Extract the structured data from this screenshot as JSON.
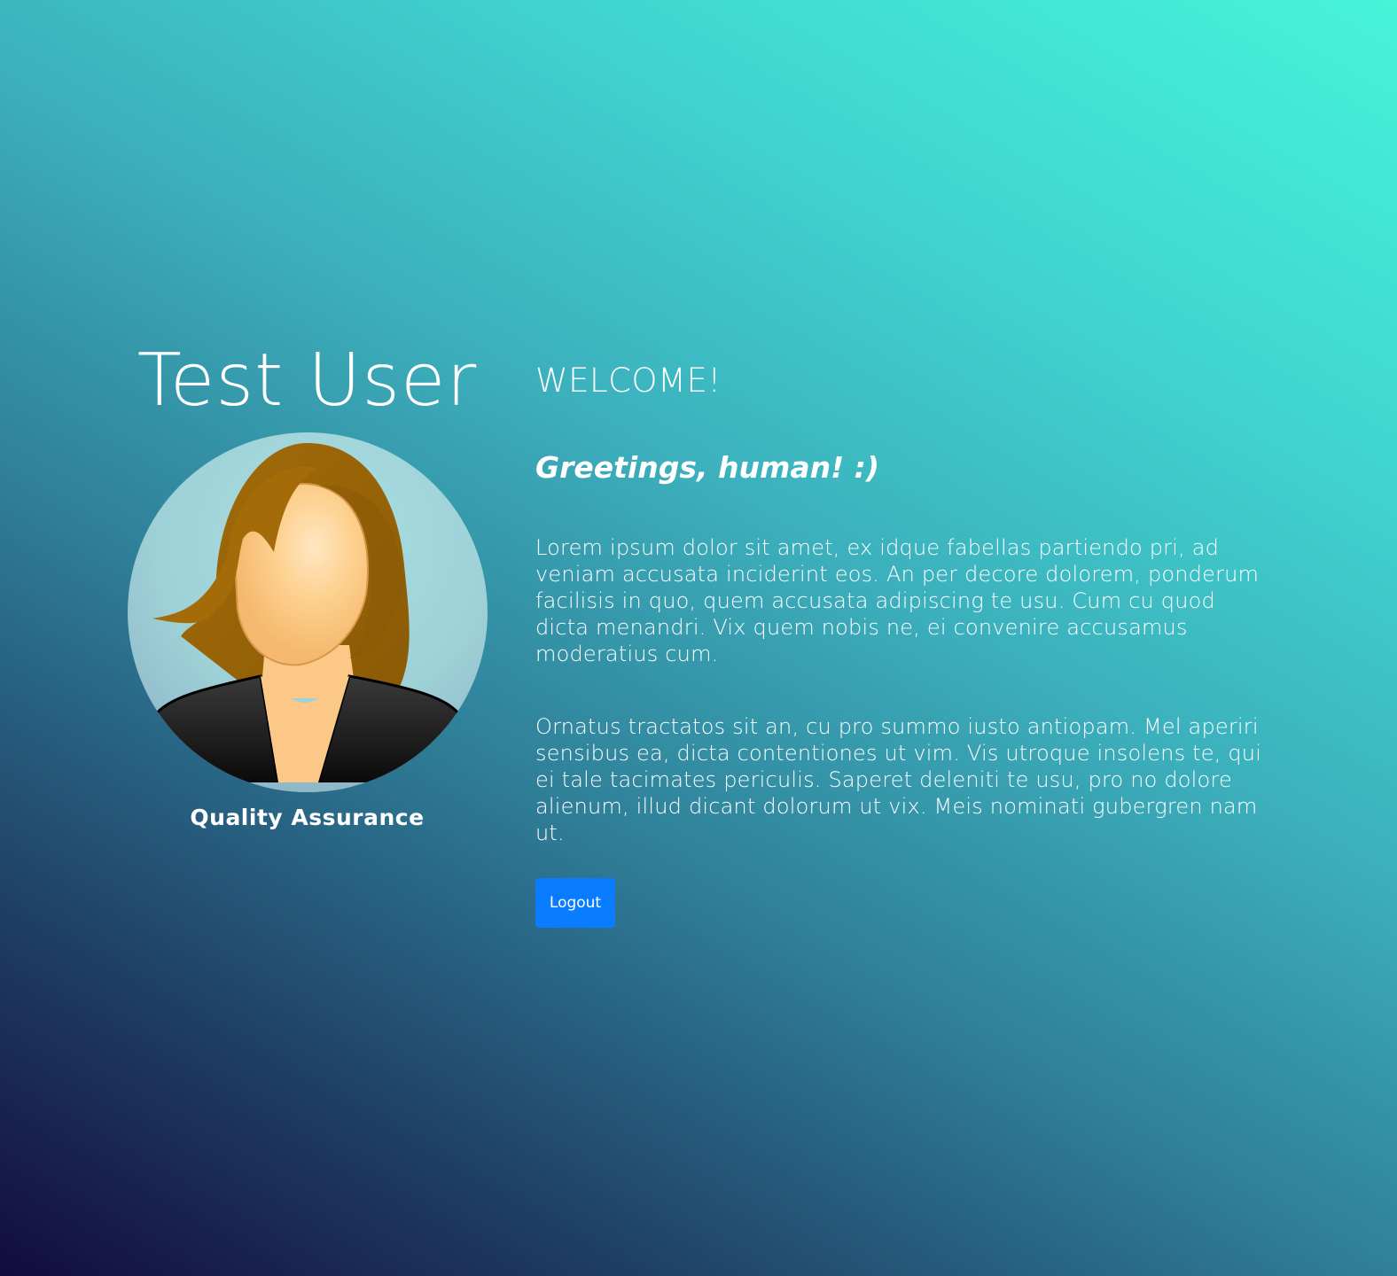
{
  "profile": {
    "name": "Test User",
    "role": "Quality Assurance",
    "avatar_icon": "female-user-avatar-icon"
  },
  "main": {
    "heading": "WELCOME!",
    "greeting": "Greetings, human! :)",
    "paragraphs": [
      "Lorem ipsum dolor sit amet, ex idque fabellas partiendo pri, ad veniam accusata inciderint eos. An per decore dolorem, ponderum facilisis in quo, quem accusata adipiscing te usu. Cum cu quod dicta menandri. Vix quem nobis ne, ei convenire accusamus moderatius cum.",
      "Ornatus tractatos sit an, cu pro summo iusto antiopam. Mel aperiri sensibus ea, dicta contentiones ut vim. Vis utroque insolens te, qui ei tale tacimates periculis. Saperet deleniti te usu, pro no dolore alienum, illud dicant dolorum ut vix. Meis nominati gubergren nam ut."
    ],
    "logout_label": "Logout"
  },
  "colors": {
    "accent": "#0a7cff",
    "gradient_start": "#130b3f",
    "gradient_end": "#46f4d8"
  }
}
